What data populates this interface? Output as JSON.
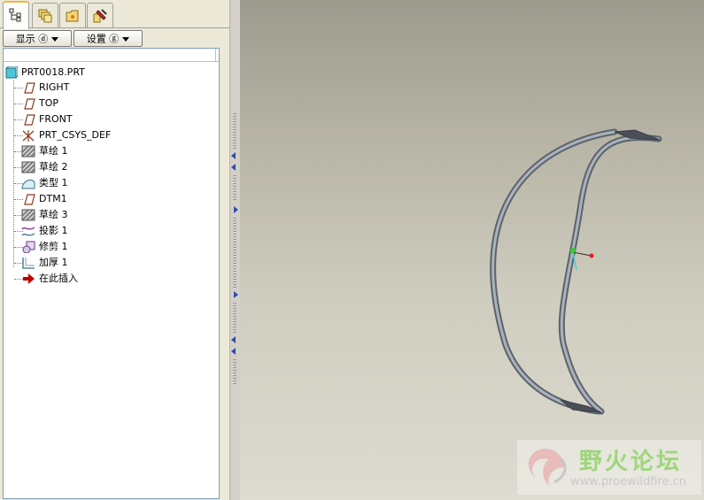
{
  "tabs": [
    {
      "name": "model-tree-icon",
      "active": true
    },
    {
      "name": "layers-icon",
      "active": false
    },
    {
      "name": "folder-icon",
      "active": false
    },
    {
      "name": "tools-icon",
      "active": false
    }
  ],
  "menu": {
    "display_label": "显示 ⓓ",
    "settings_label": "设置 ⓖ"
  },
  "model_tree": {
    "root": "PRT0018.PRT",
    "items": [
      {
        "label": "RIGHT",
        "icon": "datum-plane-icon"
      },
      {
        "label": "TOP",
        "icon": "datum-plane-icon"
      },
      {
        "label": "FRONT",
        "icon": "datum-plane-icon"
      },
      {
        "label": "PRT_CSYS_DEF",
        "icon": "csys-icon"
      },
      {
        "label": "草绘 1",
        "icon": "sketch-icon"
      },
      {
        "label": "草绘 2",
        "icon": "sketch-icon"
      },
      {
        "label": "类型 1",
        "icon": "boundary-blend-icon"
      },
      {
        "label": "DTM1",
        "icon": "datum-plane-icon"
      },
      {
        "label": "草绘 3",
        "icon": "sketch-icon"
      },
      {
        "label": "投影 1",
        "icon": "projection-icon"
      },
      {
        "label": "修剪 1",
        "icon": "trim-icon"
      },
      {
        "label": "加厚 1",
        "icon": "thicken-icon"
      },
      {
        "label": "在此插入",
        "icon": "insert-here-arrow-icon"
      }
    ]
  },
  "watermark": {
    "title": "野火论坛",
    "url": "www.proewildfire.cn"
  },
  "colors": {
    "panel_bg": "#ece9d8",
    "tree_border": "#7f9db9",
    "tab_accent": "#f5b642",
    "model_stroke": "#7d8590",
    "insert_arrow": "#c00000"
  }
}
